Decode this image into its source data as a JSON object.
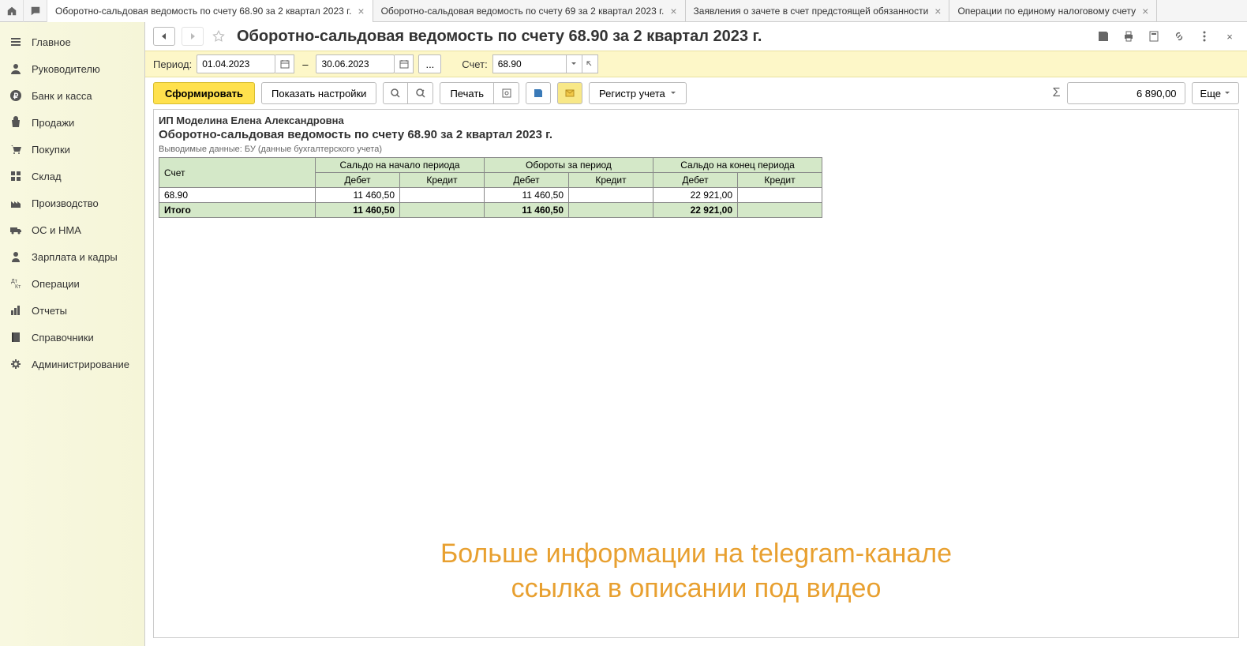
{
  "tabs": [
    {
      "label": "Оборотно-сальдовая ведомость по счету 68.90 за 2 квартал 2023 г.",
      "active": true
    },
    {
      "label": "Оборотно-сальдовая ведомость по счету 69 за 2 квартал 2023 г.",
      "active": false
    },
    {
      "label": "Заявления о зачете в счет предстоящей обязанности",
      "active": false
    },
    {
      "label": "Операции по единому налоговому счету",
      "active": false
    }
  ],
  "sidebar": {
    "items": [
      {
        "label": "Главное"
      },
      {
        "label": "Руководителю"
      },
      {
        "label": "Банк и касса"
      },
      {
        "label": "Продажи"
      },
      {
        "label": "Покупки"
      },
      {
        "label": "Склад"
      },
      {
        "label": "Производство"
      },
      {
        "label": "ОС и НМА"
      },
      {
        "label": "Зарплата и кадры"
      },
      {
        "label": "Операции"
      },
      {
        "label": "Отчеты"
      },
      {
        "label": "Справочники"
      },
      {
        "label": "Администрирование"
      }
    ]
  },
  "header": {
    "title": "Оборотно-сальдовая ведомость по счету 68.90 за 2 квартал 2023 г."
  },
  "filter": {
    "period_label": "Период:",
    "date_from": "01.04.2023",
    "date_to": "30.06.2023",
    "account_label": "Счет:",
    "account_value": "68.90",
    "ellipsis": "..."
  },
  "toolbar": {
    "form_label": "Сформировать",
    "settings_label": "Показать настройки",
    "print_label": "Печать",
    "register_label": "Регистр учета",
    "more_label": "Еще",
    "sum_value": "6 890,00"
  },
  "report": {
    "org": "ИП Моделина Елена Александровна",
    "title": "Оборотно-сальдовая ведомость по счету 68.90 за 2 квартал 2023 г.",
    "note": "Выводимые данные: БУ (данные бухгалтерского учета)",
    "columns": {
      "account": "Счет",
      "start_balance": "Сальдо на начало периода",
      "turnover": "Обороты за период",
      "end_balance": "Сальдо на конец периода",
      "debit": "Дебет",
      "credit": "Кредит"
    },
    "rows": [
      {
        "account": "68.90",
        "start_debit": "11 460,50",
        "start_credit": "",
        "turn_debit": "11 460,50",
        "turn_credit": "",
        "end_debit": "22 921,00",
        "end_credit": ""
      }
    ],
    "total": {
      "label": "Итого",
      "start_debit": "11 460,50",
      "start_credit": "",
      "turn_debit": "11 460,50",
      "turn_credit": "",
      "end_debit": "22 921,00",
      "end_credit": ""
    }
  },
  "watermark": {
    "line1": "Больше информации на telegram-канале",
    "line2": "ссылка в описании под видео"
  }
}
